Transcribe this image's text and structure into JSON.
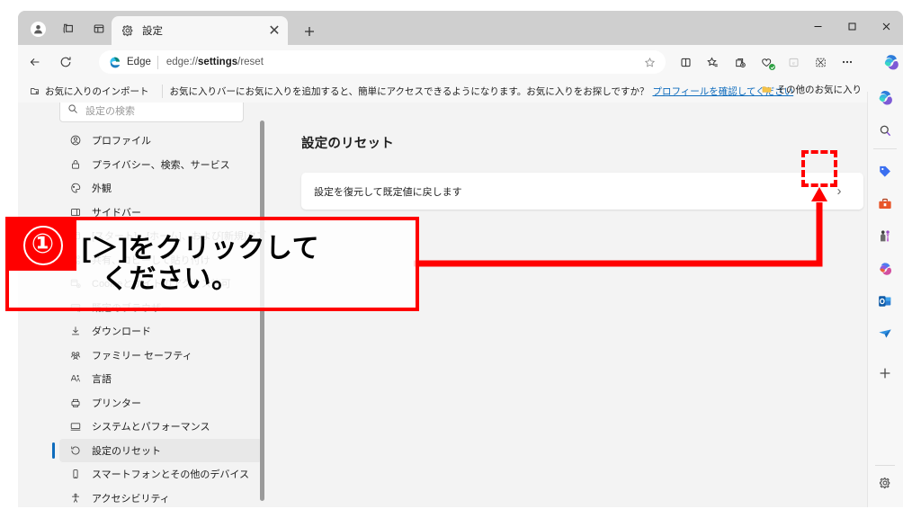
{
  "window": {
    "controls": {
      "minimize": "–",
      "maximize": "□",
      "close": "✕"
    }
  },
  "tabstrip": {
    "profile_icon": "profile-avatar-icon",
    "workspaces_icon": "workspaces-icon",
    "tab_actions_icon": "tab-actions-icon",
    "tab": {
      "title": "設定",
      "favicon": "gear-icon",
      "close": "✕"
    },
    "new_tab_label": "+"
  },
  "addressbar": {
    "back": "←",
    "refresh": "↻",
    "edge_label": "Edge",
    "url_prefix": "edge://",
    "url_bold": "settings",
    "url_suffix": "/reset",
    "url_full": "edge://settings/reset",
    "favorite_icon": "star-icon",
    "tools": [
      {
        "name": "split-screen-icon",
        "label": ""
      },
      {
        "name": "favorites-icon",
        "label": ""
      },
      {
        "name": "collections-icon",
        "label": ""
      },
      {
        "name": "browser-essentials-icon",
        "label": ""
      },
      {
        "name": "ie-mode-icon",
        "label": "e"
      },
      {
        "name": "extensions-icon",
        "label": ""
      },
      {
        "name": "settings-more-icon",
        "label": "⋯"
      }
    ],
    "copilot_icon": "copilot-icon"
  },
  "bookmarkbar": {
    "import_label": "お気に入りのインポート",
    "message": "お気に入りバーにお気に入りを追加すると、簡単にアクセスできるようになります。お気に入りをお探しですか？",
    "link": "プロフィールを確認してください",
    "other_favorites": "その他のお気に入り"
  },
  "settings_sidebar": {
    "search_placeholder": "設定の検索",
    "items": [
      {
        "label": "プロファイル",
        "icon": "profile-icon",
        "selected": false,
        "ghost": false
      },
      {
        "label": "プライバシー、検索、サービス",
        "icon": "lock-icon",
        "selected": false,
        "ghost": false
      },
      {
        "label": "外観",
        "icon": "appearance-icon",
        "selected": false,
        "ghost": false
      },
      {
        "label": "サイドバー",
        "icon": "sidebar-icon",
        "selected": false,
        "ghost": false
      },
      {
        "label": "[スタート]、[ホーム]、および[新規]タブ",
        "icon": "start-home-icon",
        "selected": false,
        "ghost": true
      },
      {
        "label": "共有、コピーして貼り付け",
        "icon": "share-icon",
        "selected": false,
        "ghost": true
      },
      {
        "label": "Cookieとサイトのアクセス許可",
        "icon": "cookies-icon",
        "selected": false,
        "ghost": true
      },
      {
        "label": "既定のブラウザー",
        "icon": "default-browser-icon",
        "selected": false,
        "ghost": true
      },
      {
        "label": "ダウンロード",
        "icon": "download-icon",
        "selected": false,
        "ghost": false
      },
      {
        "label": "ファミリー セーフティ",
        "icon": "family-safety-icon",
        "selected": false,
        "ghost": false
      },
      {
        "label": "言語",
        "icon": "language-icon",
        "selected": false,
        "ghost": false
      },
      {
        "label": "プリンター",
        "icon": "printer-icon",
        "selected": false,
        "ghost": false
      },
      {
        "label": "システムとパフォーマンス",
        "icon": "system-icon",
        "selected": false,
        "ghost": false
      },
      {
        "label": "設定のリセット",
        "icon": "reset-icon",
        "selected": true,
        "ghost": false
      },
      {
        "label": "スマートフォンとその他のデバイス",
        "icon": "phone-icon",
        "selected": false,
        "ghost": false
      },
      {
        "label": "アクセシビリティ",
        "icon": "accessibility-icon",
        "selected": false,
        "ghost": false
      }
    ]
  },
  "main": {
    "heading": "設定のリセット",
    "row_label": "設定を復元して既定値に戻します",
    "row_chevron": "›"
  },
  "right_rail": {
    "items": [
      {
        "name": "copilot-rail-icon"
      },
      {
        "name": "search-rail-icon"
      },
      {
        "name": "shopping-tag-icon"
      },
      {
        "name": "tools-toolbox-icon"
      },
      {
        "name": "games-icon"
      },
      {
        "name": "microsoft365-icon"
      },
      {
        "name": "outlook-icon"
      },
      {
        "name": "drop-plane-icon"
      }
    ],
    "add_label": "+",
    "settings_icon": "gear-icon"
  },
  "annotation": {
    "number": "①",
    "line1": "[＞]をクリックして",
    "line2": "ください。",
    "accent_color": "#ff0000"
  }
}
